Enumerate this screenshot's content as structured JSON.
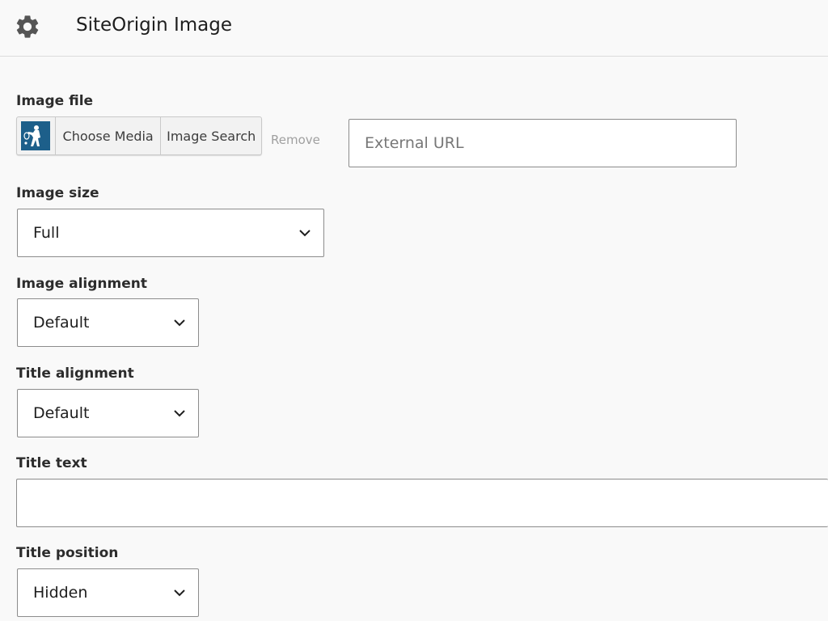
{
  "header": {
    "title": "SiteOrigin Image",
    "icon": "gear-icon"
  },
  "image_file": {
    "label": "Image file",
    "choose_media_label": "Choose Media",
    "image_search_label": "Image Search",
    "remove_label": "Remove",
    "external_url_placeholder": "External URL",
    "external_url_value": ""
  },
  "image_size": {
    "label": "Image size",
    "selected": "Full"
  },
  "image_alignment": {
    "label": "Image alignment",
    "selected": "Default"
  },
  "title_alignment": {
    "label": "Title alignment",
    "selected": "Default"
  },
  "title_text": {
    "label": "Title text",
    "value": ""
  },
  "title_position": {
    "label": "Title position",
    "selected": "Hidden"
  },
  "colors": {
    "background": "#f9f9f9",
    "thumbnail": "#1d5f8a",
    "border": "#8c8c8c"
  }
}
